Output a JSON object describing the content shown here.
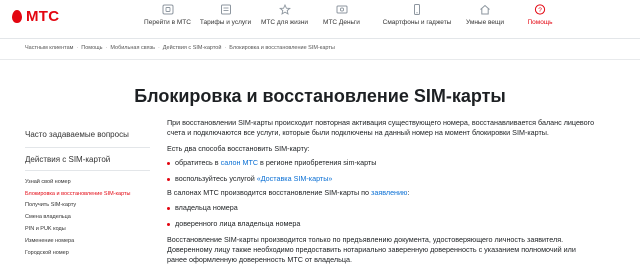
{
  "brand": {
    "logo_text": "МТС",
    "accent": "#e30611",
    "link_color": "#0a6fd4"
  },
  "nav": [
    {
      "label": "Перейти в МТС",
      "icon": "sim-icon"
    },
    {
      "label": "Тарифы и услуги",
      "icon": "tariffs-icon"
    },
    {
      "label": "МТС для жизни",
      "icon": "star-icon"
    },
    {
      "label": "МТС Деньги",
      "icon": "money-icon"
    },
    {
      "label": "Смартфоны и гаджеты",
      "icon": "smartphone-icon"
    },
    {
      "label": "Умные вещи",
      "icon": "smart-home-icon"
    },
    {
      "label": "Помощь",
      "icon": "help-icon"
    }
  ],
  "breadcrumb": [
    "Частным клиентам",
    "Помощь",
    "Мобильная связь",
    "Действия с SIM-картой",
    "Блокировка и восстановление SIM-карты"
  ],
  "page_title": "Блокировка и восстановление SIM-карты",
  "sidebar": {
    "faq_label": "Часто задаваемые вопросы",
    "section_label": "Действия с SIM-картой",
    "items": [
      "Узнай свой номер",
      "Блокировка и восстановление SIM-карты",
      "Получить SIM-карту",
      "Смена владельца",
      "PIN и PUK коды",
      "Изменение номера",
      "Городской номер"
    ]
  },
  "content": {
    "intro_line1": "При восстановлении SIM-карты происходит повторная активация существующего номера, восстанавливается баланс лицевого",
    "intro_line2": "счета и подключаются все услуги, которые были подключены на данный номер на момент блокировки SIM-карты.",
    "ways_heading": "Есть два способа восстановить SIM-карту:",
    "way1_before": "обратитесь в ",
    "way1_link": "салон МТС",
    "way1_after": " в регионе приобретения sim-карты",
    "way2_before": "воспользуйтесь услугой ",
    "way2_link": "«Доставка SIM-карты»",
    "salons_before": "В салонах МТС производится восстановление SIM-карты по ",
    "salons_link": "заявлению",
    "salons_after": ":",
    "holder1": "владельца номера",
    "holder2": "доверенного лица владельца номера",
    "final_line1": "Восстановление SIM-карты производится только по предъявлению документа, удостоверяющего личность заявителя.",
    "final_line2": "Доверенному лицу также необходимо предоставить нотариально заверенную доверенность с указанием полномочий или",
    "final_line3": "ранее оформленную доверенность МТС от владельца."
  }
}
